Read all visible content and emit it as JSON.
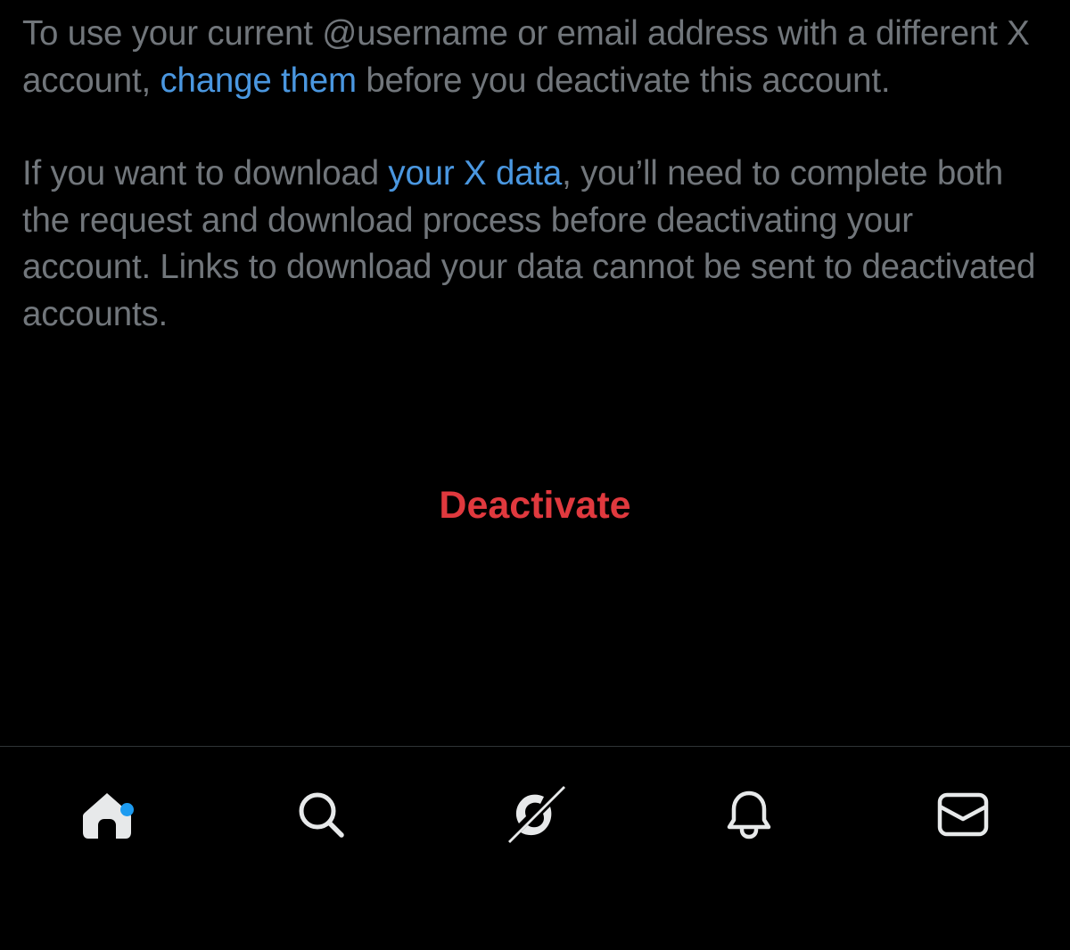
{
  "paragraph1": {
    "before": "To use your current @username or email address with a different X account, ",
    "link": "change them",
    "after": " before you deactivate this account."
  },
  "paragraph2": {
    "before": "If you want to download ",
    "link": "your X data",
    "after": ", you’ll need to complete both the request and download process before deactivating your account. Links to download your data cannot be sent to deactivated accounts."
  },
  "deactivate_label": "Deactivate",
  "colors": {
    "background": "#000000",
    "body_text": "#71767b",
    "link": "#4a97e0",
    "danger": "#e0393e",
    "badge": "#1d9bf0",
    "icon": "#e7e9ea"
  },
  "tabbar": {
    "items": [
      {
        "name": "home",
        "icon": "home-icon",
        "active": true,
        "badge": true
      },
      {
        "name": "search",
        "icon": "search-icon"
      },
      {
        "name": "grok",
        "icon": "grok-icon"
      },
      {
        "name": "notifications",
        "icon": "bell-icon"
      },
      {
        "name": "messages",
        "icon": "mail-icon"
      }
    ]
  }
}
